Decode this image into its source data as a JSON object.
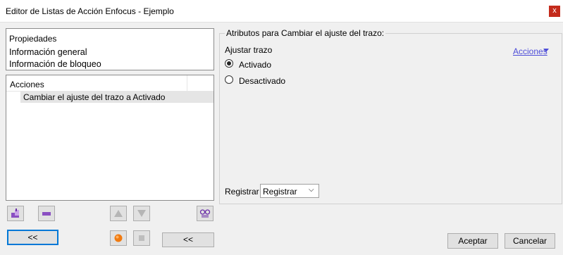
{
  "window": {
    "title": "Editor de Listas de Acción Enfocus - Ejemplo",
    "close_glyph": "x"
  },
  "properties": {
    "header": "Propiedades",
    "items": [
      "Información general",
      "Información de bloqueo"
    ]
  },
  "actions_list": {
    "header": "Acciones",
    "items": [
      "Cambiar el ajuste del trazo a Activado"
    ]
  },
  "attributes": {
    "group_title": "Atributos para Cambiar el ajuste del trazo:",
    "field_label": "Ajustar trazo",
    "actions_link": "Acciones",
    "options": [
      {
        "label": "Activado",
        "selected": true
      },
      {
        "label": "Desactivado",
        "selected": false
      }
    ],
    "register_label": "Registrar",
    "register_value": "Registrar"
  },
  "buttons": {
    "left_collapse": "<<",
    "mid_collapse": "<<",
    "ok": "Aceptar",
    "cancel": "Cancelar"
  },
  "icons": {
    "add": "add-action-icon",
    "remove": "remove-action-icon",
    "up": "move-up-icon",
    "down": "move-down-icon",
    "preview": "preview-glasses-icon",
    "record": "record-icon",
    "stop": "stop-icon"
  }
}
